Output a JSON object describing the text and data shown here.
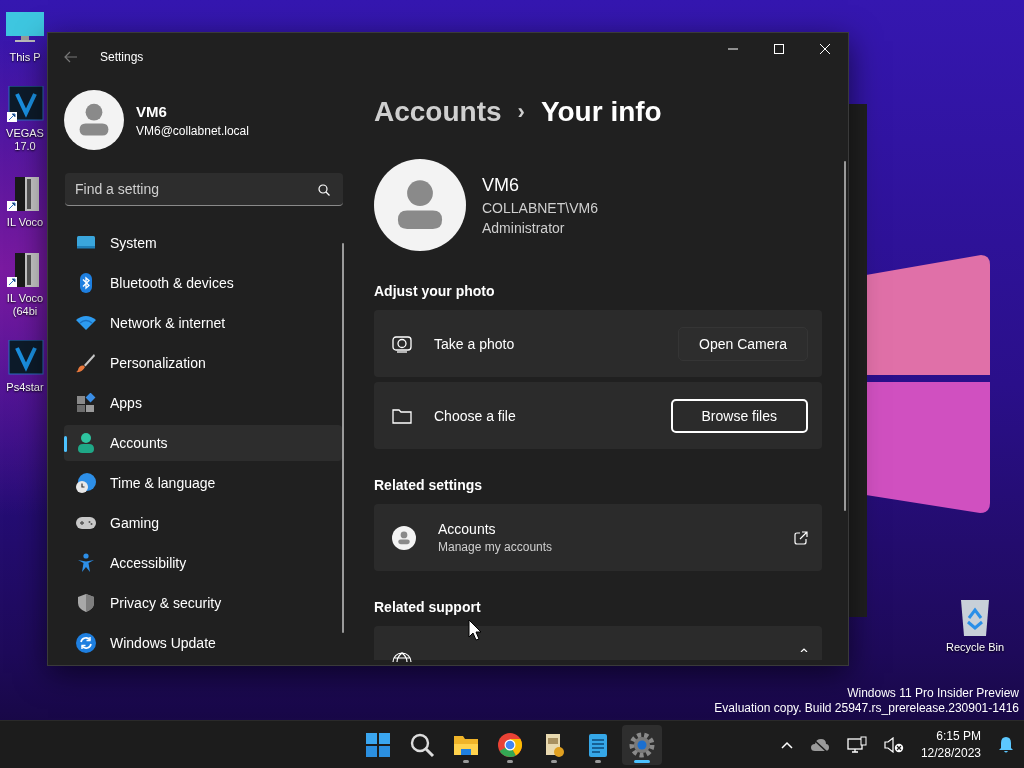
{
  "desktop": {
    "icons": [
      {
        "label": "This P"
      },
      {
        "label": "VEGAS 17.0"
      },
      {
        "label": "IL Voco"
      },
      {
        "label": "IL Voco (64bi"
      },
      {
        "label": "Ps4star"
      }
    ],
    "recycle_bin": {
      "label": "Recycle Bin"
    },
    "watermark": [
      "Windows 11 Pro Insider Preview",
      "Evaluation copy. Build 25947.rs_prerelease.230901-1416"
    ]
  },
  "settings": {
    "title": "Settings",
    "account": {
      "name": "VM6",
      "email": "VM6@collabnet.local"
    },
    "search": {
      "placeholder": "Find a setting"
    },
    "nav": [
      {
        "label": "System",
        "selected": false
      },
      {
        "label": "Bluetooth & devices",
        "selected": false
      },
      {
        "label": "Network & internet",
        "selected": false
      },
      {
        "label": "Personalization",
        "selected": false
      },
      {
        "label": "Apps",
        "selected": false
      },
      {
        "label": "Accounts",
        "selected": true
      },
      {
        "label": "Time & language",
        "selected": false
      },
      {
        "label": "Gaming",
        "selected": false
      },
      {
        "label": "Accessibility",
        "selected": false
      },
      {
        "label": "Privacy & security",
        "selected": false
      },
      {
        "label": "Windows Update",
        "selected": false
      }
    ],
    "breadcrumb": {
      "parent": "Accounts",
      "separator": "›",
      "current": "Your info"
    },
    "profile": {
      "name": "VM6",
      "domain": "COLLABNET\\VM6",
      "role": "Administrator"
    },
    "sections": [
      {
        "heading": "Adjust your photo",
        "rows": [
          {
            "kind": "camera",
            "title": "Take a photo",
            "button": "Open Camera",
            "focused": false
          },
          {
            "kind": "file",
            "title": "Choose a file",
            "button": "Browse files",
            "focused": true
          }
        ]
      },
      {
        "heading": "Related settings",
        "rows": [
          {
            "kind": "link",
            "title": "Accounts",
            "subtitle": "Manage my accounts"
          }
        ]
      },
      {
        "heading": "Related support",
        "rows": [
          {
            "kind": "expander"
          }
        ]
      }
    ]
  },
  "taskbar": {
    "apps": [
      {
        "kind": "start",
        "running": false,
        "active": false
      },
      {
        "kind": "search",
        "running": false,
        "active": false
      },
      {
        "kind": "explorer",
        "running": true,
        "active": false
      },
      {
        "kind": "browser",
        "running": true,
        "active": false
      },
      {
        "kind": "installer",
        "running": true,
        "active": false
      },
      {
        "kind": "notepad",
        "running": true,
        "active": false
      },
      {
        "kind": "settings",
        "running": true,
        "active": true
      }
    ],
    "time": "6:15 PM",
    "date": "12/28/2023"
  }
}
